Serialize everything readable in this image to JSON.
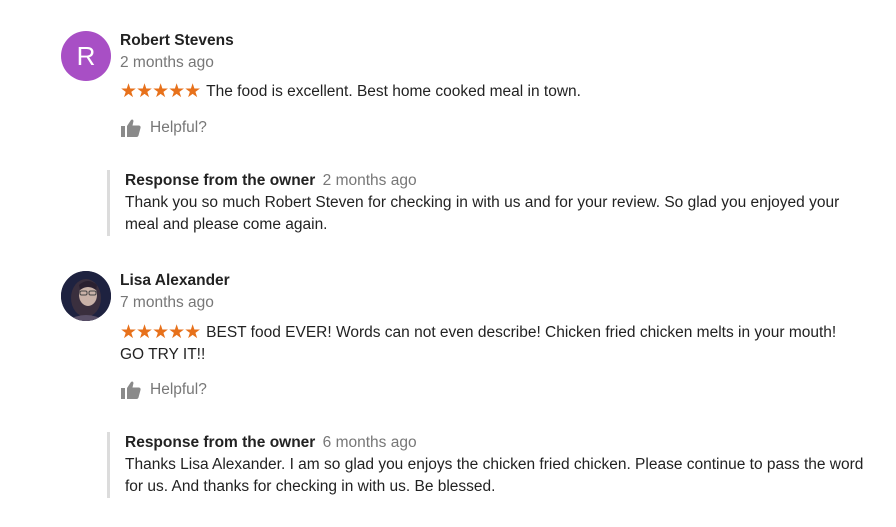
{
  "reviews": [
    {
      "avatar_letter": "R",
      "avatar_color": "#a84fc5",
      "name": "Robert Stevens",
      "time": "2 months ago",
      "rating": 5,
      "stars": "★★★★★",
      "text": "The food is excellent.  Best home cooked meal in town.",
      "helpful_label": "Helpful?",
      "owner_response": {
        "label": "Response from the owner",
        "time": "2 months ago",
        "text": "Thank you so much Robert Steven for checking in with us and for your review. So glad you enjoyed your meal and please come again."
      }
    },
    {
      "avatar_letter": "",
      "avatar_color": "#1e2240",
      "name": "Lisa Alexander",
      "time": "7 months ago",
      "rating": 5,
      "stars": "★★★★★",
      "text": "BEST food EVER! Words can not even describe! Chicken fried chicken melts in your mouth! GO TRY IT!!",
      "helpful_label": "Helpful?",
      "owner_response": {
        "label": "Response from the owner",
        "time": "6 months ago",
        "text": "Thanks Lisa Alexander. I am so glad you enjoys the chicken fried chicken. Please continue to pass the word for us. And thanks for checking in with us. Be blessed."
      }
    }
  ],
  "colors": {
    "star": "#e7711b",
    "muted_text": "#777777",
    "owner_border": "#dcdcdc"
  },
  "icons": {
    "helpful": "thumbs-up-icon"
  }
}
